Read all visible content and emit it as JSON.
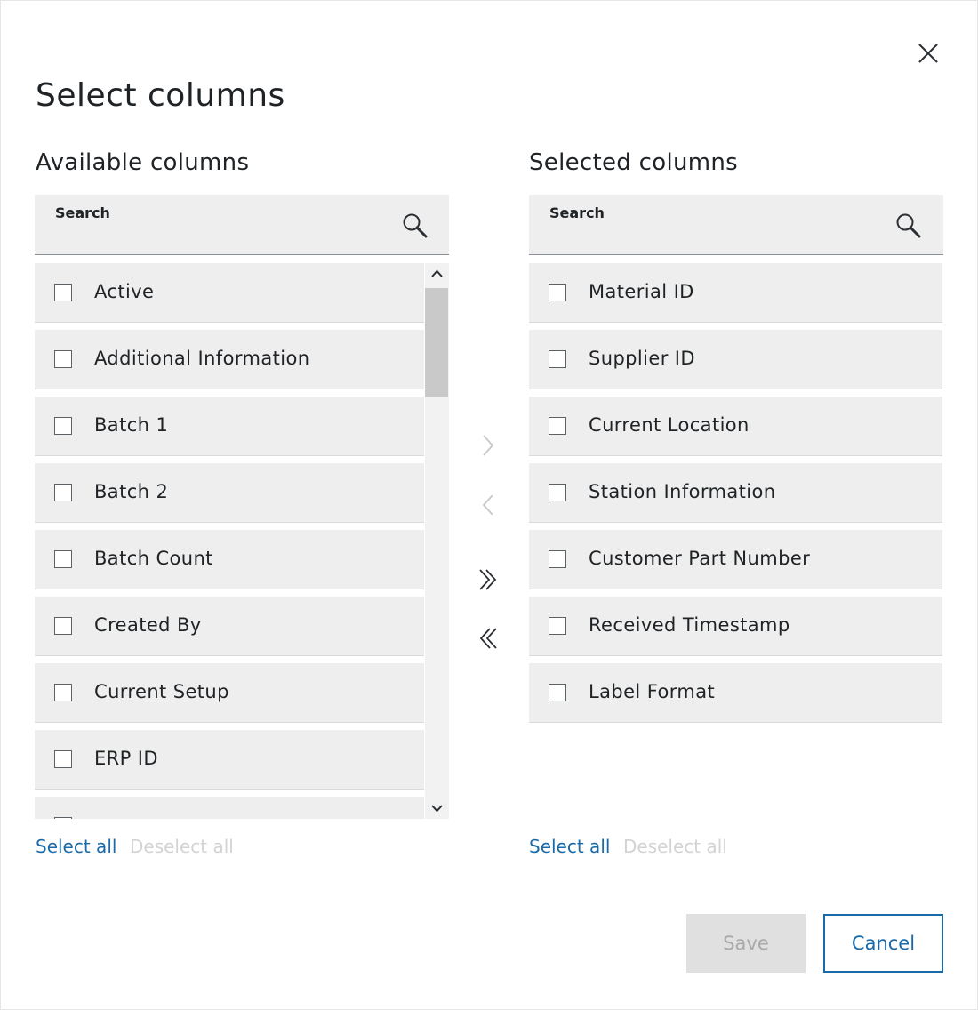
{
  "dialog": {
    "title": "Select columns",
    "close_icon": "close-icon"
  },
  "available": {
    "heading": "Available columns",
    "search_label": "Search",
    "search_value": "",
    "search_icon": "search-icon",
    "items": [
      {
        "label": "Active",
        "checked": false
      },
      {
        "label": "Additional Information",
        "checked": false
      },
      {
        "label": "Batch 1",
        "checked": false
      },
      {
        "label": "Batch 2",
        "checked": false
      },
      {
        "label": "Batch Count",
        "checked": false
      },
      {
        "label": "Created By",
        "checked": false
      },
      {
        "label": "Current Setup",
        "checked": false
      },
      {
        "label": "ERP ID",
        "checked": false
      },
      {
        "label": "",
        "checked": false
      }
    ],
    "select_all": "Select all",
    "deselect_all": "Deselect all"
  },
  "selected": {
    "heading": "Selected columns",
    "search_label": "Search",
    "search_value": "",
    "search_icon": "search-icon",
    "items": [
      {
        "label": "Material ID",
        "checked": false
      },
      {
        "label": "Supplier ID",
        "checked": false
      },
      {
        "label": "Current Location",
        "checked": false
      },
      {
        "label": "Station Information",
        "checked": false
      },
      {
        "label": "Customer Part Number",
        "checked": false
      },
      {
        "label": "Received Timestamp",
        "checked": false
      },
      {
        "label": "Label Format",
        "checked": false
      }
    ],
    "select_all": "Select all",
    "deselect_all": "Deselect all"
  },
  "transfer": {
    "move_right_icon": "chevron-right-icon",
    "move_left_icon": "chevron-left-icon",
    "move_all_right_icon": "double-chevron-right-icon",
    "move_all_left_icon": "double-chevron-left-icon"
  },
  "actions": {
    "save_label": "Save",
    "cancel_label": "Cancel"
  },
  "colors": {
    "accent": "#1a6aa8",
    "item_background": "#eeeeee",
    "disabled_text": "#d3d3d3"
  }
}
